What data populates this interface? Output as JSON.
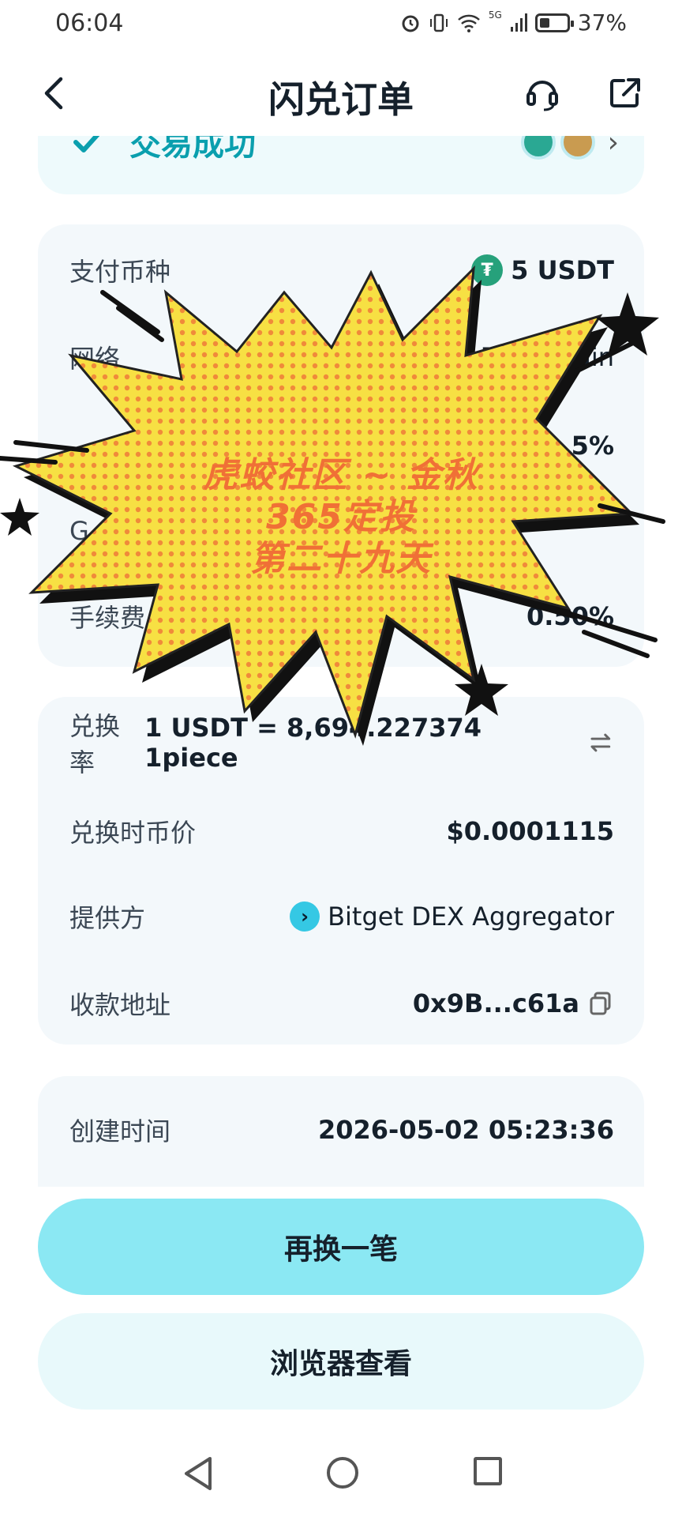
{
  "status_bar": {
    "time": "06:04",
    "icons": [
      "alarm-icon",
      "vibrate-icon",
      "wifi-icon",
      "signal-5g-icon"
    ],
    "network": "5G",
    "battery": "37%"
  },
  "nav": {
    "title": "闪兑订单",
    "back_icon": "chevron-left-icon",
    "support_icon": "headset-icon",
    "share_icon": "external-link-icon"
  },
  "order_status": {
    "label": "交易成功"
  },
  "details": [
    {
      "label": "支付币种",
      "value": "5 USDT"
    },
    {
      "label": "网络",
      "value": "BNB Chain"
    },
    {
      "label": "",
      "value": "5%"
    },
    {
      "label": "G",
      "value": ""
    },
    {
      "label": "手续费",
      "value": "0.50%"
    }
  ],
  "exchange": {
    "rate_label": "兑换率",
    "rate_value": "1 USDT = 8,694.227374 1piece",
    "price_label": "兑换时币价",
    "price_value": "$0.0001115",
    "provider_label": "提供方",
    "provider_value": "Bitget DEX Aggregator",
    "address_label": "收款地址",
    "address_value": "0x9B...c61a"
  },
  "time_card": {
    "label": "创建时间",
    "value": "2026-05-02 05:23:36"
  },
  "buttons": {
    "primary": "再换一笔",
    "secondary": "浏览器查看"
  },
  "overlay": {
    "line1": "虎蛟社区 ~ 金秋",
    "line2": "365定投",
    "line3": "第二十九天"
  },
  "colors": {
    "accent": "#8be8f3",
    "success": "#0a9fae",
    "burst": "#f7e043",
    "overlay_text": "#f07036"
  }
}
